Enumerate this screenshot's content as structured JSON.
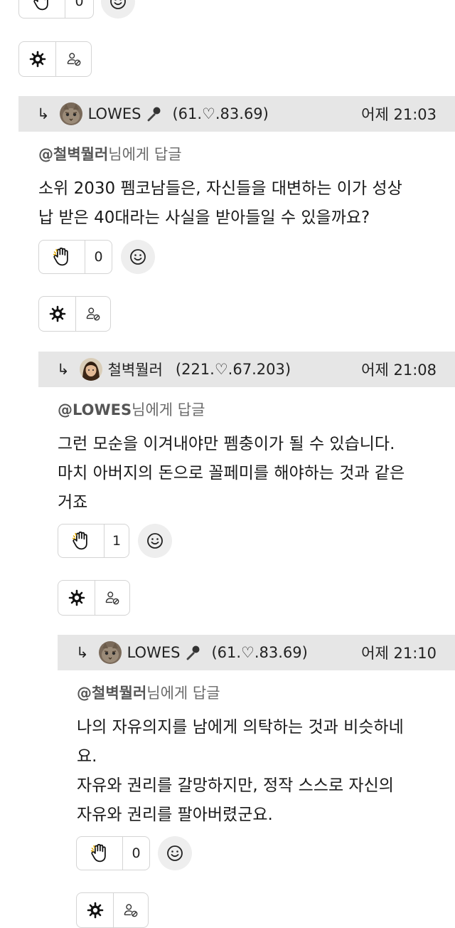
{
  "colors": {
    "header_bg": "#e6e6e6",
    "border": "#d4d4d4",
    "emoji_bg": "#eeeeee",
    "text": "#1a1a1a",
    "muted": "#6b6b6b"
  },
  "top_partial": {
    "like_count": "0"
  },
  "comments": [
    {
      "arrow": "↳",
      "nickname": "LOWES",
      "has_mic": true,
      "ip": "(61.♡.83.69)",
      "time": "어제 21:03",
      "reply_target": "@철벽뭘러",
      "reply_suffix": "님에게 답글",
      "text": "소위 2030 펨코남들은, 자신들을 대변하는 이가 성상\n납 받은 40대라는 사실을 받아들일 수 있을까요?",
      "like_count": "0",
      "avatar": "cat"
    },
    {
      "arrow": "↳",
      "nickname": "철벽뭘러",
      "has_mic": false,
      "ip": "(221.♡.67.203)",
      "time": "어제 21:08",
      "reply_target": "@LOWES",
      "reply_suffix": "님에게 답글",
      "text": "그런 모순을 이겨내야만  펨충이가 될 수 있습니다.\n마치 아버지의 돈으로 꼴페미를 해야하는 것과 같은\n거죠",
      "like_count": "1",
      "avatar": "person"
    },
    {
      "arrow": "↳",
      "nickname": "LOWES",
      "has_mic": true,
      "ip": "(61.♡.83.69)",
      "time": "어제 21:10",
      "reply_target": "@철벽뭘러",
      "reply_suffix": "님에게 답글",
      "text": "나의 자유의지를 남에게 의탁하는 것과 비슷하네\n요.\n자유와 권리를 갈망하지만, 정작 스스로 자신의\n자유와 권리를 팔아버렸군요.",
      "like_count": "0",
      "avatar": "cat"
    }
  ],
  "icons": {
    "like": "clapping-hand-icon",
    "emoji": "smiley-icon",
    "settings": "gear-icon",
    "block": "user-block-icon",
    "mic": "microphone-icon"
  }
}
